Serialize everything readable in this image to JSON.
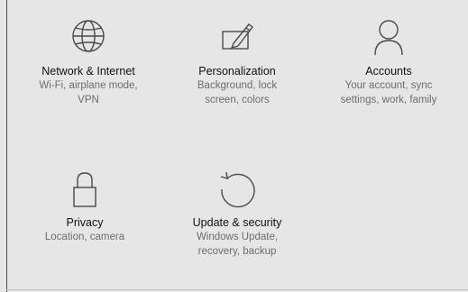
{
  "theme": {
    "background": "#e6e6e6",
    "title_color": "#111111",
    "desc_color": "#6d6d6d",
    "icon_color": "#4a4a4a"
  },
  "tiles": [
    {
      "icon": "globe-icon",
      "title": "Network & Internet",
      "desc_line1": "Wi-Fi, airplane mode,",
      "desc_line2": "VPN"
    },
    {
      "icon": "personalization-icon",
      "title": "Personalization",
      "desc_line1": "Background, lock",
      "desc_line2": "screen, colors"
    },
    {
      "icon": "person-icon",
      "title": "Accounts",
      "desc_line1": "Your account, sync",
      "desc_line2": "settings, work, family"
    },
    {
      "icon": "lock-icon",
      "title": "Privacy",
      "desc_line1": "Location, camera",
      "desc_line2": ""
    },
    {
      "icon": "refresh-icon",
      "title": "Update & security",
      "desc_line1": "Windows Update,",
      "desc_line2": "recovery, backup"
    }
  ]
}
